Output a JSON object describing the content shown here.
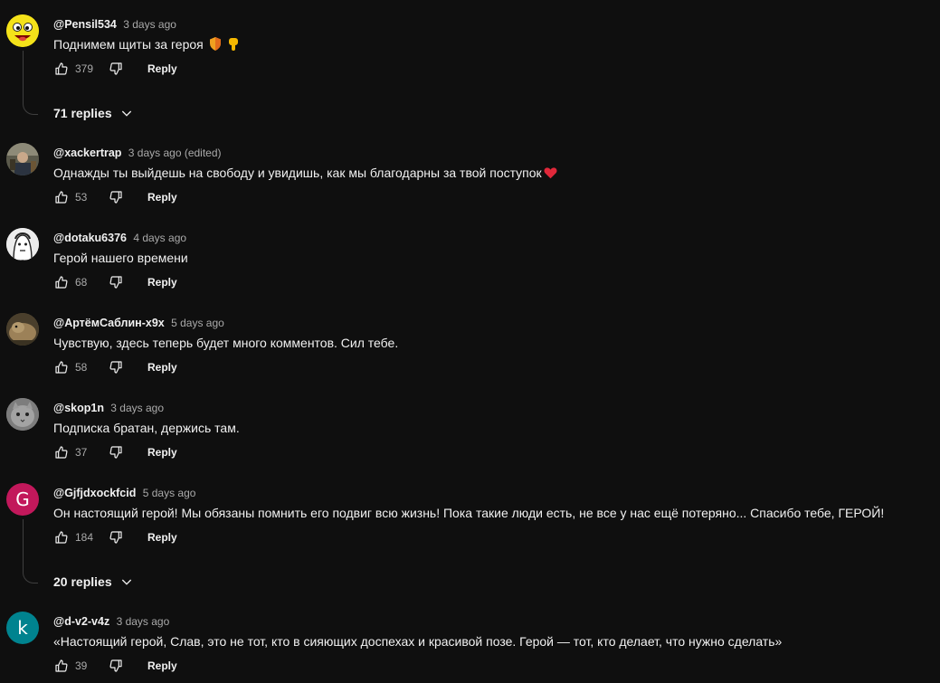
{
  "comments": [
    {
      "author": "@Pensil534",
      "time": "3 days ago",
      "text": "Поднимем щиты за героя",
      "emoji": [
        "shield-emoji",
        "pointing-down-emoji"
      ],
      "likes": "379",
      "reply_label": "Reply",
      "replies_label": "71 replies",
      "avatar_icon": "smiley-face-avatar"
    },
    {
      "author": "@xackertrap",
      "time": "3 days ago (edited)",
      "text": "Однажды ты выйдешь на свободу и увидишь, как мы благодарны за твой поступок",
      "emoji": [
        "red-heart-emoji"
      ],
      "likes": "53",
      "reply_label": "Reply",
      "avatar_icon": "photo-avatar"
    },
    {
      "author": "@dotaku6376",
      "time": "4 days ago",
      "text": "Герой нашего времени",
      "likes": "68",
      "reply_label": "Reply",
      "avatar_icon": "meme-face-avatar"
    },
    {
      "author": "@АртёмСаблин-x9x",
      "time": "5 days ago",
      "text": "Чувствую, здесь теперь будет много комментов. Сил тебе.",
      "likes": "58",
      "reply_label": "Reply",
      "avatar_icon": "animal-photo-avatar"
    },
    {
      "author": "@skop1n",
      "time": "3 days ago",
      "text": "Подписка братан, держись там.",
      "likes": "37",
      "reply_label": "Reply",
      "avatar_icon": "cat-photo-avatar"
    },
    {
      "author": "@Gjfjdxockfcid",
      "time": "5 days ago",
      "text": "Он настоящий герой! Мы обязаны помнить его подвиг всю жизнь! Пока такие люди есть, не все у нас ещё потеряно... Спасибо тебе, ГЕРОЙ!",
      "likes": "184",
      "reply_label": "Reply",
      "replies_label": "20 replies",
      "avatar_letter": "G",
      "avatar_color": "#c2185b"
    },
    {
      "author": "@d-v2-v4z",
      "time": "3 days ago",
      "text": "«Настоящий герой, Слав, это не тот, кто в сияющих доспехах и красивой позе. Герой — тот, кто делает, что нужно сделать»",
      "likes": "39",
      "reply_label": "Reply",
      "avatar_letter": "k",
      "avatar_color": "#00838f"
    }
  ],
  "icons": {
    "like": "thumbs-up-icon",
    "dislike": "thumbs-down-icon",
    "expand": "chevron-down-icon"
  },
  "colors": {
    "background": "#0f0f0f",
    "text_primary": "#f1f1f1",
    "text_secondary": "#aaaaaa",
    "thread_line": "#3f3f3f"
  }
}
